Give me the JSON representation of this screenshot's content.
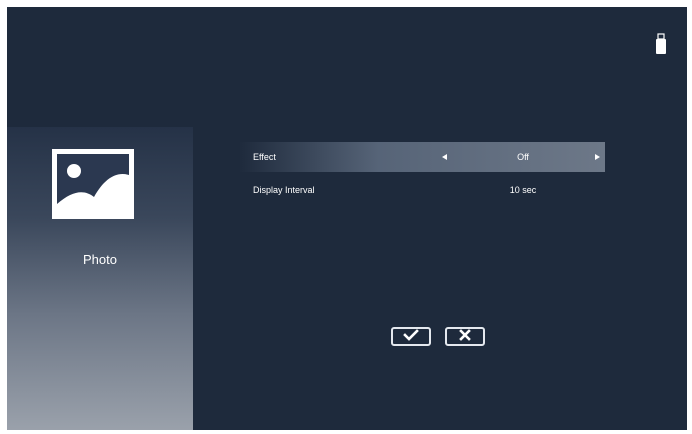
{
  "sidebar": {
    "icon": "photo-icon",
    "label": "Photo"
  },
  "status": {
    "icon": "usb-drive-icon"
  },
  "settings": {
    "effect": {
      "label": "Effect",
      "value": "Off"
    },
    "display_interval": {
      "label": "Display Interval",
      "value": "10 sec"
    }
  },
  "actions": {
    "confirm_icon": "checkmark-icon",
    "cancel_icon": "close-icon"
  },
  "colors": {
    "background": "#1e2a3c",
    "sidebar_gradient_bottom": "#9aa1ab",
    "highlight_row": "#6d7888",
    "text": "#ffffff"
  }
}
